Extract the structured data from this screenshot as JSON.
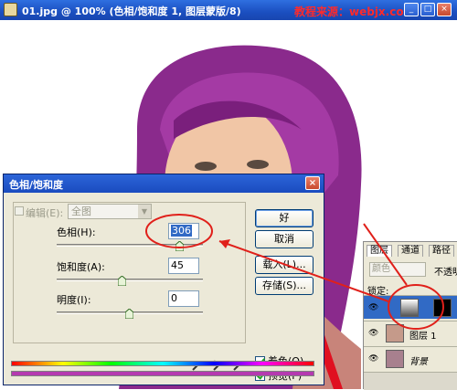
{
  "document": {
    "title": "01.jpg @ 100% (色相/饱和度 1, 图层蒙版/8)",
    "watermark": "教程来源：webjx.com",
    "window_buttons": [
      "_",
      "□",
      "×"
    ]
  },
  "dialog": {
    "title": "色相/饱和度",
    "close_label": "×",
    "edit_label": "编辑(E):",
    "edit_value": "全图",
    "hue_label": "色相(H):",
    "hue_value": "306",
    "saturation_label": "饱和度(A):",
    "saturation_value": "45",
    "lightness_label": "明度(I):",
    "lightness_value": "0",
    "buttons": {
      "ok": "好",
      "cancel": "取消",
      "load": "载入(L)...",
      "save": "存储(S)..."
    },
    "colorize_label": "着色(O)",
    "colorize_checked": true,
    "preview_label": "预览(P)",
    "preview_checked": true,
    "hue_slider_level": 0.85,
    "saturation_slider_level": 0.45,
    "lightness_slider_level": 0.5,
    "colors": {
      "accent_circle": "#e0201a",
      "hair_purple": "#8a2a8c",
      "lower_bar": "#b53ab0"
    }
  },
  "layers_panel": {
    "tabs": [
      "图层",
      "通道",
      "路径"
    ],
    "blend_mode": "颜色",
    "opacity_label": "不透明",
    "lock_label": "锁定:",
    "layers": [
      {
        "name": "",
        "type": "adjustment"
      },
      {
        "name": "图层 1",
        "type": "image"
      },
      {
        "name": "背景",
        "type": "background"
      }
    ]
  }
}
